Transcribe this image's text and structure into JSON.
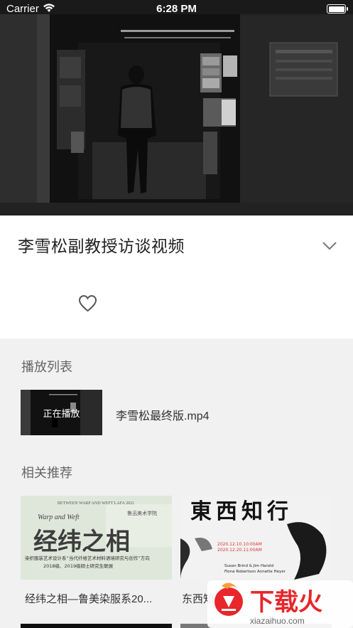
{
  "status_bar": {
    "carrier": "Carrier",
    "time": "6:28 PM"
  },
  "video": {
    "title": "李雪松副教授访谈视频"
  },
  "playlist": {
    "heading": "播放列表",
    "items": [
      {
        "status": "正在播放",
        "name": "李雪松最终版.mp4"
      }
    ]
  },
  "recommended": {
    "heading": "相关推荐",
    "items": [
      {
        "label": "经纬之相—鲁美染服系20...",
        "poster": {
          "top_line": "BETWEEN WARP AND WEFT   LAFA 2021",
          "subtitle_en": "Warp and Weft",
          "school": "鲁迅美术学院",
          "big": "经纬之相",
          "desc1": "染织服装艺术设计系“当代纤维艺术材料语境研究与创作”方向",
          "desc2": "2018级、2019级硕士研究生联展"
        }
      },
      {
        "label": "东西知行",
        "poster": {
          "big": "東西知行",
          "date1": "2020.12.10.10:00AM",
          "date2": "2020.12.20.11:00AM",
          "names1": "Susan Brind & Jim Harold",
          "names2": "Fiona Robertson    Annette Heyer"
        }
      }
    ]
  },
  "watermark": {
    "text": "下载火",
    "url": "xiazaihuo.com"
  },
  "colors": {
    "card_bg": "#ffffff",
    "page_bg": "#f1f1f1",
    "watermark_red": "#e8262b",
    "poster_green": "#dfe7da"
  }
}
